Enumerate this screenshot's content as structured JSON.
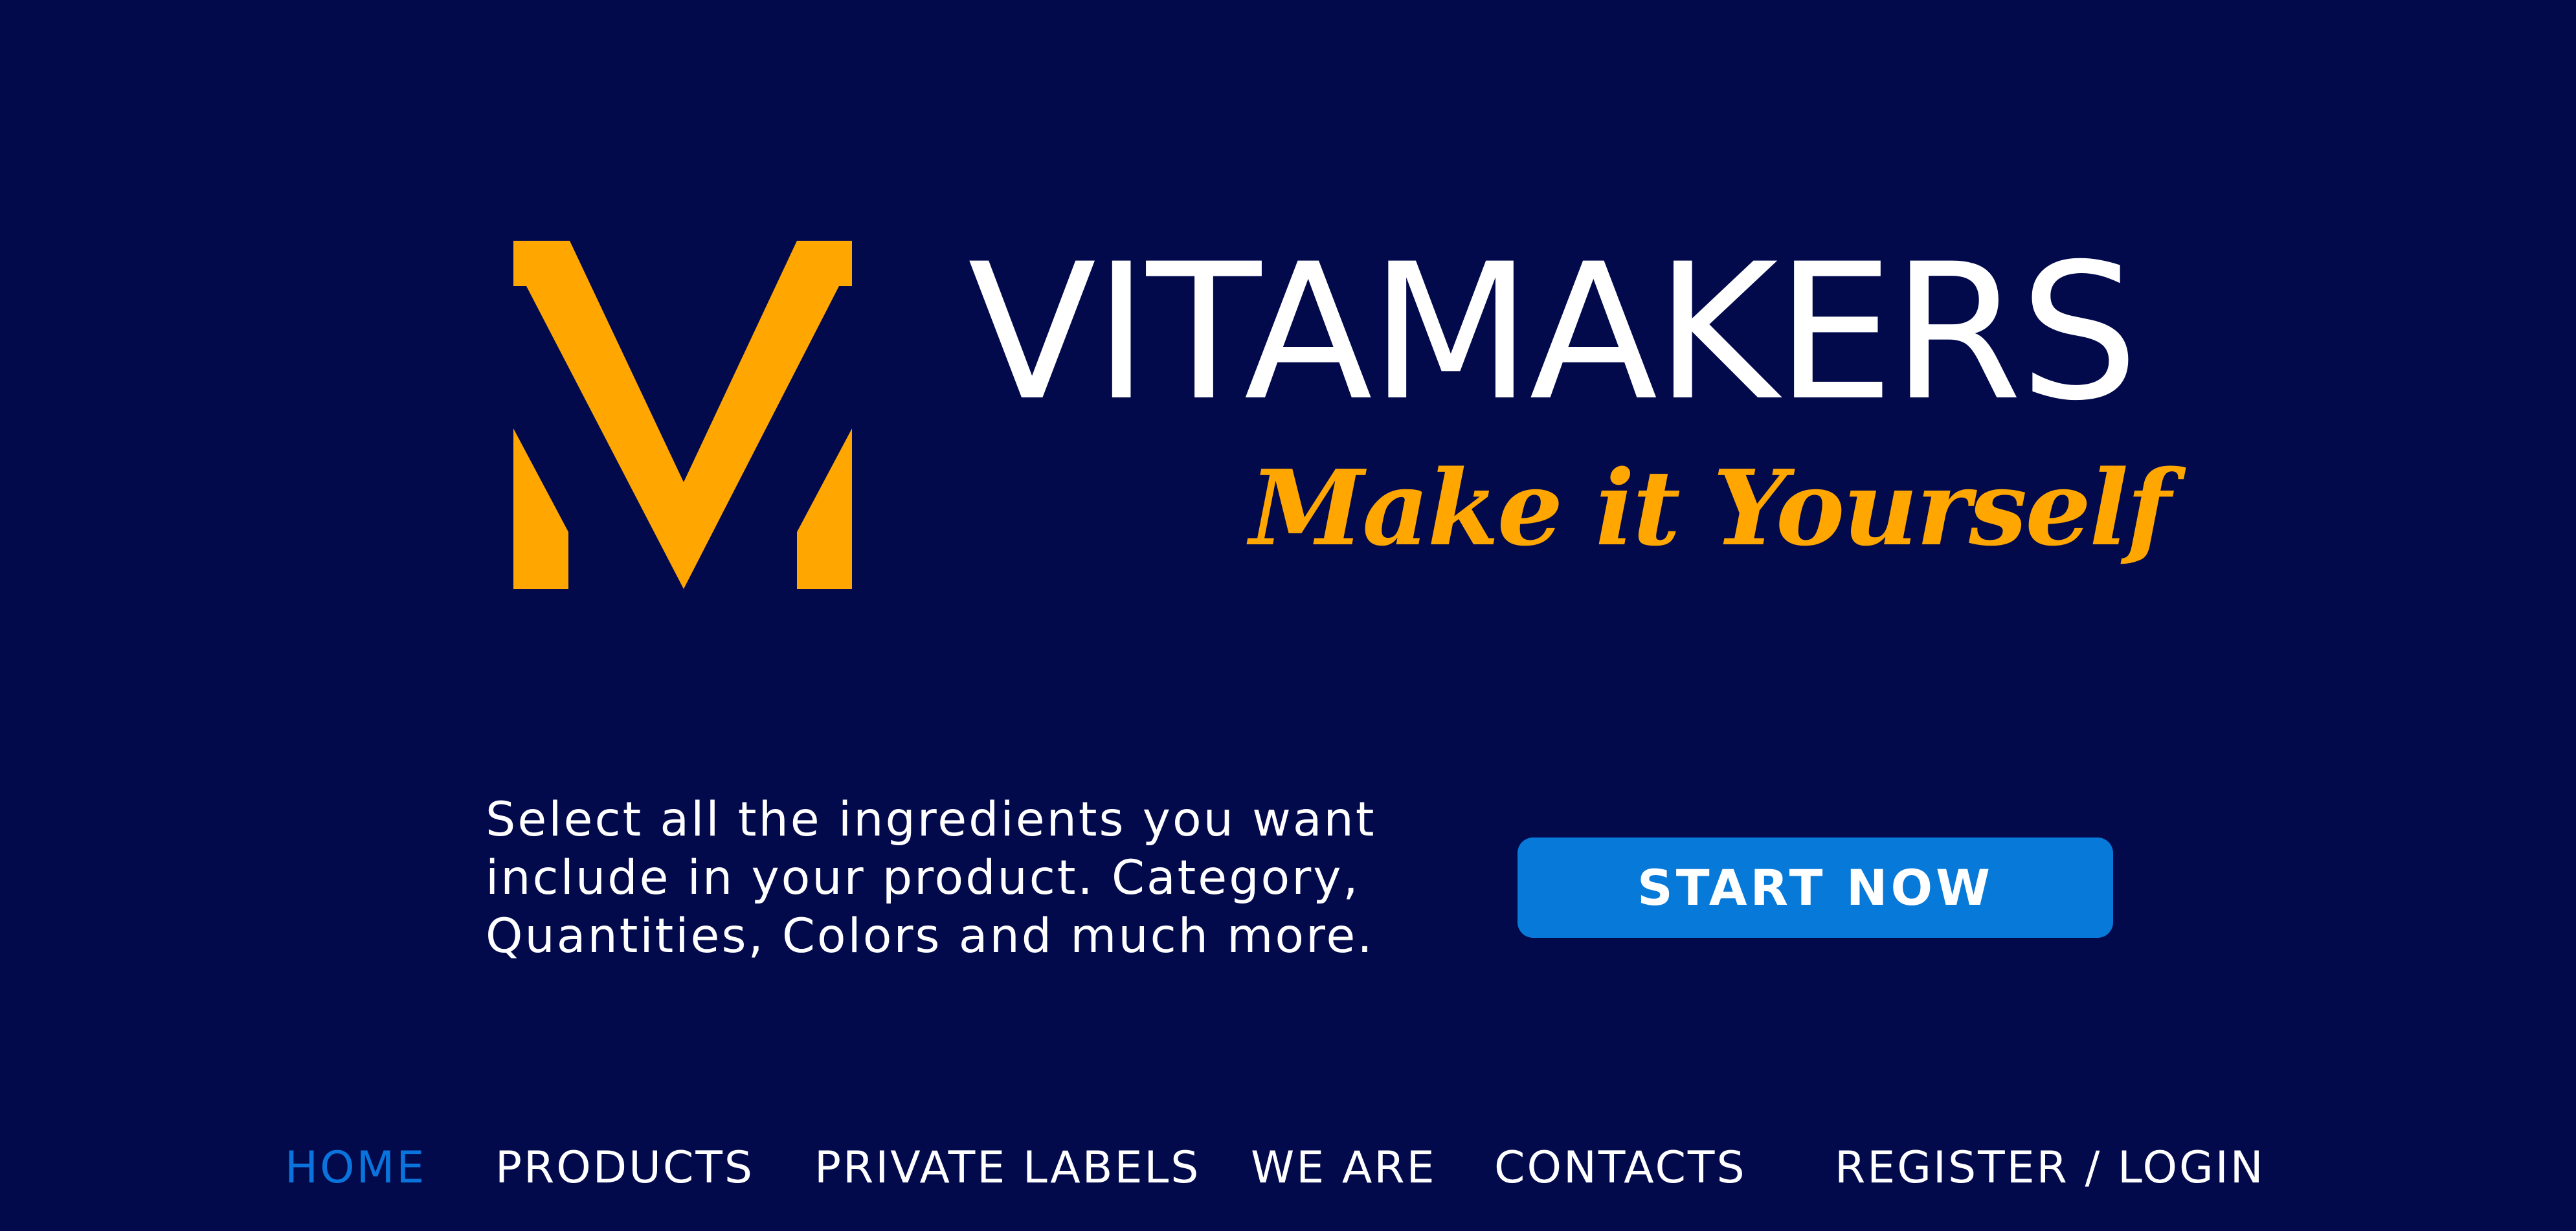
{
  "brand": {
    "name": "VITAMAKERS",
    "tagline": "Make it Yourself",
    "accent_color": "#ffa600",
    "background_color": "#020a4c"
  },
  "hero": {
    "intro_lines": [
      "Select all the ingredients you want",
      "include in your product. Category,",
      "Quantities, Colors and much more."
    ],
    "cta_label": "START NOW",
    "cta_color": "#0779d9"
  },
  "nav": {
    "items": [
      {
        "label": "HOME",
        "active": true
      },
      {
        "label": "PRODUCTS",
        "active": false
      },
      {
        "label": "PRIVATE LABELS",
        "active": false
      },
      {
        "label": "WE ARE",
        "active": false
      },
      {
        "label": "CONTACTS",
        "active": false
      },
      {
        "label": "REGISTER / LOGIN",
        "active": false
      }
    ],
    "active_color": "#0a74dc"
  }
}
